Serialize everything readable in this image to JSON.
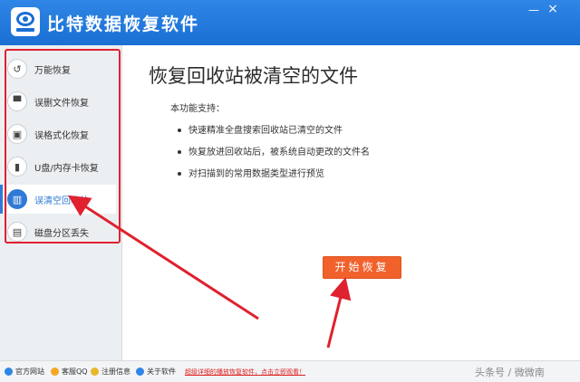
{
  "app": {
    "title": "比特数据恢复软件",
    "min_glyph": "—",
    "close_glyph": "×"
  },
  "sidebar": {
    "items": [
      {
        "label": "万能恢复",
        "icon": "refresh-icon",
        "glyph": "↺"
      },
      {
        "label": "误删文件恢复",
        "icon": "folder-icon",
        "glyph": "▀"
      },
      {
        "label": "误格式化恢复",
        "icon": "disk-icon",
        "glyph": "▣"
      },
      {
        "label": "U盘/内存卡恢复",
        "icon": "lock-icon",
        "glyph": "▮"
      },
      {
        "label": "误清空回收站",
        "icon": "trash-icon",
        "glyph": "▥",
        "active": true
      },
      {
        "label": "磁盘分区丢失",
        "icon": "partition-icon",
        "glyph": "▤"
      }
    ],
    "active_color": "#2f7ad6"
  },
  "main": {
    "title": "恢复回收站被清空的文件",
    "intro": "本功能支持：",
    "features": [
      "快速精准全盘搜索回收站已清空的文件",
      "恢复放进回收站后，被系统自动更改的文件名",
      "对扫描到的常用数据类型进行预览"
    ],
    "start_button": "开始恢复",
    "button_color": "#f0612c"
  },
  "footer": {
    "links": [
      {
        "label": "官方网站",
        "icon": "globe-icon",
        "color": "#2f86e6"
      },
      {
        "label": "客服QQ",
        "icon": "qq-icon",
        "color": "#f5a623"
      },
      {
        "label": "注册信息",
        "icon": "key-icon",
        "color": "#e8b72a"
      },
      {
        "label": "关于软件",
        "icon": "info-icon",
        "color": "#2f86e6"
      }
    ],
    "notice": "超级详细的播放恢复软件，点击立即观看！",
    "watermark": "头条号 / 微微南"
  },
  "colors": {
    "titlebar": "#1a6fd3",
    "annotation_red": "#e0212f"
  }
}
